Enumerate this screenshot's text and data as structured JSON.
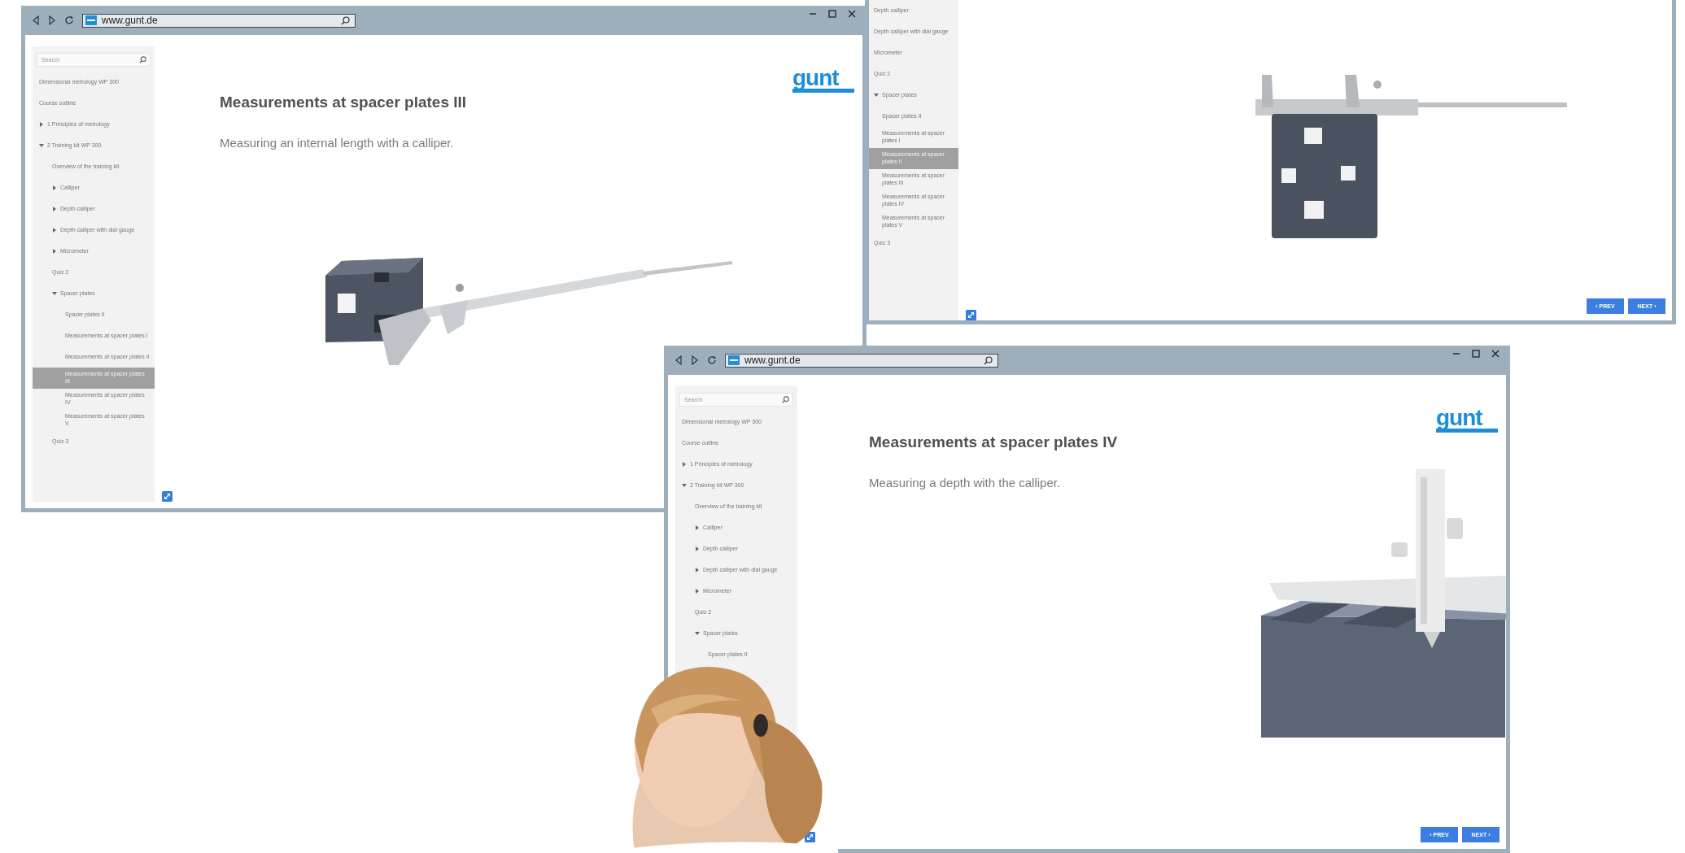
{
  "windows": [
    {
      "url": "www.gunt.de",
      "search": {
        "placeholder": "Search"
      },
      "logo": "gunt",
      "heading": "Measurements at spacer plates III",
      "subtitle": "Measuring an internal length with a calliper.",
      "picture": {
        "kind": "picture"
      },
      "sidebar": {
        "items": [
          {
            "label": "Dimensional metrology WP 300",
            "selected": false
          },
          {
            "label": "Course outline",
            "selected": false
          },
          {
            "label": "1 Principles of metrology",
            "expanded": false,
            "selected": false
          },
          {
            "label": "2 Training kit WP 300",
            "expanded": true,
            "selected": false,
            "children": [
              {
                "label": "Overview of the training kit",
                "selected": false
              },
              {
                "label": "Calliper",
                "expanded": false,
                "selected": false
              },
              {
                "label": "Depth calliper",
                "expanded": false,
                "selected": false
              },
              {
                "label": "Depth calliper with dial gauge",
                "expanded": false,
                "selected": false
              },
              {
                "label": "Micrometer",
                "expanded": false,
                "selected": false
              },
              {
                "label": "Quiz 2",
                "selected": false
              },
              {
                "label": "Spacer plates",
                "expanded": true,
                "selected": false,
                "children": [
                  {
                    "label": "Spacer plates II",
                    "selected": false
                  },
                  {
                    "label": "Measurements at spacer plates I",
                    "selected": false
                  },
                  {
                    "label": "Measurements at spacer plates II",
                    "selected": false
                  },
                  {
                    "label": "Measurements at spacer plates III",
                    "selected": true
                  },
                  {
                    "label": "Measurements at spacer plates IV",
                    "selected": false
                  },
                  {
                    "label": "Measurements at spacer plates V",
                    "selected": false
                  }
                ]
              },
              {
                "label": "Quiz 3",
                "selected": false
              }
            ]
          }
        ]
      }
    },
    {
      "picture": {
        "kind": "picture"
      },
      "buttons": [
        {
          "label": "‹ PREV"
        },
        {
          "label": "NEXT ›"
        }
      ],
      "sidebar": {
        "items": [
          {
            "label": "Depth calliper",
            "selected": false
          },
          {
            "label": "Depth calliper with dial gauge",
            "selected": false
          },
          {
            "label": "Micrometer",
            "selected": false
          },
          {
            "label": "Quiz 2",
            "selected": false
          },
          {
            "label": "Spacer plates",
            "selected": false,
            "expanded": true,
            "children": [
              {
                "label": "Spacer plates II",
                "selected": false
              },
              {
                "label": "Measurements at spacer plates I",
                "selected": false
              },
              {
                "label": "Measurements at spacer plates II",
                "selected": true
              },
              {
                "label": "Measurements at spacer plates III",
                "selected": false
              },
              {
                "label": "Measurements at spacer plates IV",
                "selected": false
              },
              {
                "label": "Measurements at spacer plates V",
                "selected": false
              }
            ]
          },
          {
            "label": "Quiz 3",
            "selected": false
          }
        ]
      }
    },
    {
      "url": "www.gunt.de",
      "search": {
        "placeholder": "Search"
      },
      "logo": "gunt",
      "heading": "Measurements at spacer plates IV",
      "subtitle": "Measuring a depth with the calliper.",
      "picture": {
        "kind": "picture"
      },
      "buttons": [
        {
          "label": "‹ PREV"
        },
        {
          "label": "NEXT ›"
        }
      ],
      "sidebar": {
        "items": [
          {
            "label": "Dimensional metrology WP 300",
            "selected": false
          },
          {
            "label": "Course outline",
            "selected": false
          },
          {
            "label": "1 Principles of metrology",
            "expanded": false,
            "selected": false
          },
          {
            "label": "2 Training kit WP 300",
            "expanded": true,
            "selected": false,
            "children": [
              {
                "label": "Overview of the training kit",
                "selected": false
              },
              {
                "label": "Calliper",
                "expanded": false,
                "selected": false
              },
              {
                "label": "Depth calliper",
                "expanded": false,
                "selected": false
              },
              {
                "label": "Depth calliper with dial gauge",
                "expanded": false,
                "selected": false
              },
              {
                "label": "Micrometer",
                "expanded": false,
                "selected": false
              },
              {
                "label": "Quiz 2",
                "selected": false
              },
              {
                "label": "Spacer plates",
                "expanded": true,
                "selected": false,
                "children": [
                  {
                    "label": "Spacer plates II",
                    "selected": false
                  }
                ]
              }
            ]
          }
        ]
      }
    }
  ],
  "person": {
    "kind": "picture"
  }
}
